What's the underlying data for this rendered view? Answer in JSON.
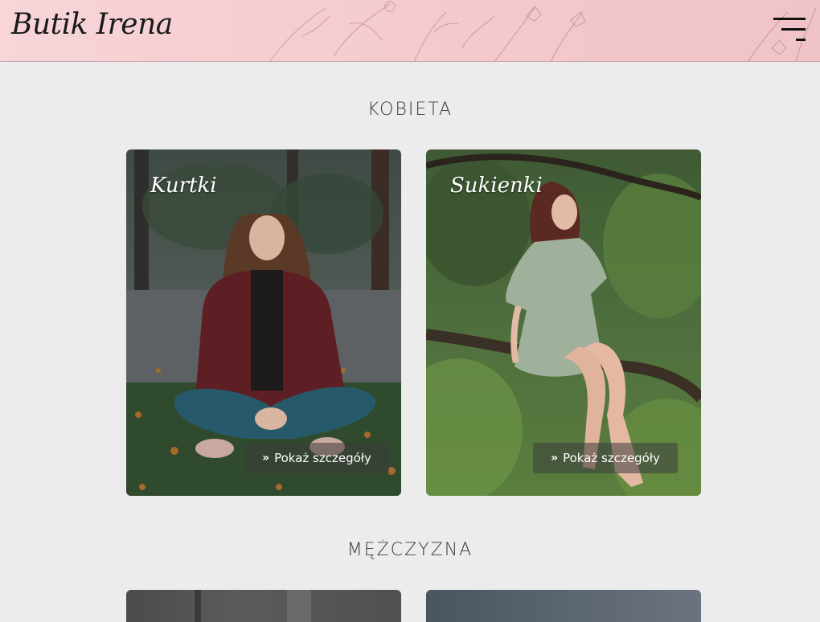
{
  "header": {
    "brand": "Butik Irena",
    "menu_icon": "hamburger-menu-icon",
    "accent_color": "#f4c9cd"
  },
  "sections": [
    {
      "title": "KOBIETA",
      "cards": [
        {
          "title": "Kurtki",
          "button_label": "Pokaż szczegóły",
          "button_icon": "double-chevron-right-icon"
        },
        {
          "title": "Sukienki",
          "button_label": "Pokaż szczegóły",
          "button_icon": "double-chevron-right-icon"
        }
      ]
    },
    {
      "title": "MĘŻCZYZNA",
      "cards": [
        {
          "title": ""
        },
        {
          "title": ""
        }
      ]
    }
  ]
}
